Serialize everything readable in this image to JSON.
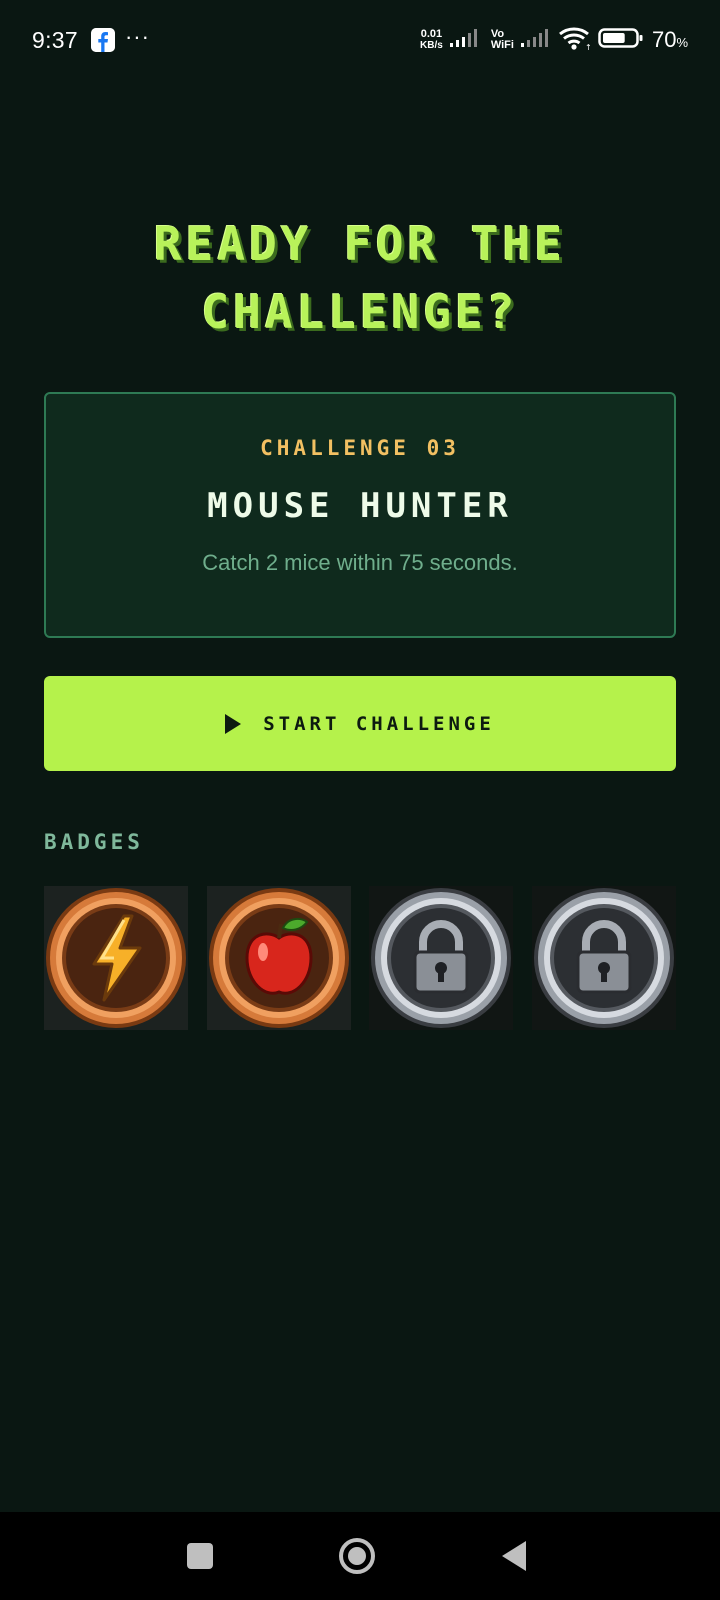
{
  "status_bar": {
    "time": "9:37",
    "notification_icons": [
      "facebook-icon",
      "more-dots-icon"
    ],
    "net_speed_value": "0.01",
    "net_speed_unit": "KB/s",
    "vo_label": "Vo",
    "wifi_label": "WiFi",
    "battery_percent": "70",
    "battery_percent_sign": "%",
    "battery_level": 0.7
  },
  "headline": {
    "line1": "READY FOR THE",
    "line2": "CHALLENGE?"
  },
  "challenge": {
    "number_label": "CHALLENGE 03",
    "name": "MOUSE HUNTER",
    "description": "Catch 2 mice within 75 seconds."
  },
  "start_button": {
    "label": "START CHALLENGE",
    "icon": "play-icon"
  },
  "badges": {
    "label": "BADGES",
    "items": [
      {
        "icon": "lightning-bolt-icon",
        "tier": "bronze",
        "locked": false
      },
      {
        "icon": "apple-icon",
        "tier": "bronze",
        "locked": false
      },
      {
        "icon": "padlock-icon",
        "tier": "silver",
        "locked": true
      },
      {
        "icon": "padlock-icon",
        "tier": "silver",
        "locked": true
      }
    ]
  },
  "nav_bar": {
    "buttons": [
      "recents-square-icon",
      "home-circle-icon",
      "back-triangle-icon"
    ]
  },
  "colors": {
    "background": "#0a1712",
    "accent_green": "#b5f24b",
    "headline_green": "#b8f25a",
    "challenge_number": "#f2c062",
    "card_border": "#2e7a54",
    "card_background": "#0f2a1d",
    "muted_text": "#6fae8c"
  }
}
